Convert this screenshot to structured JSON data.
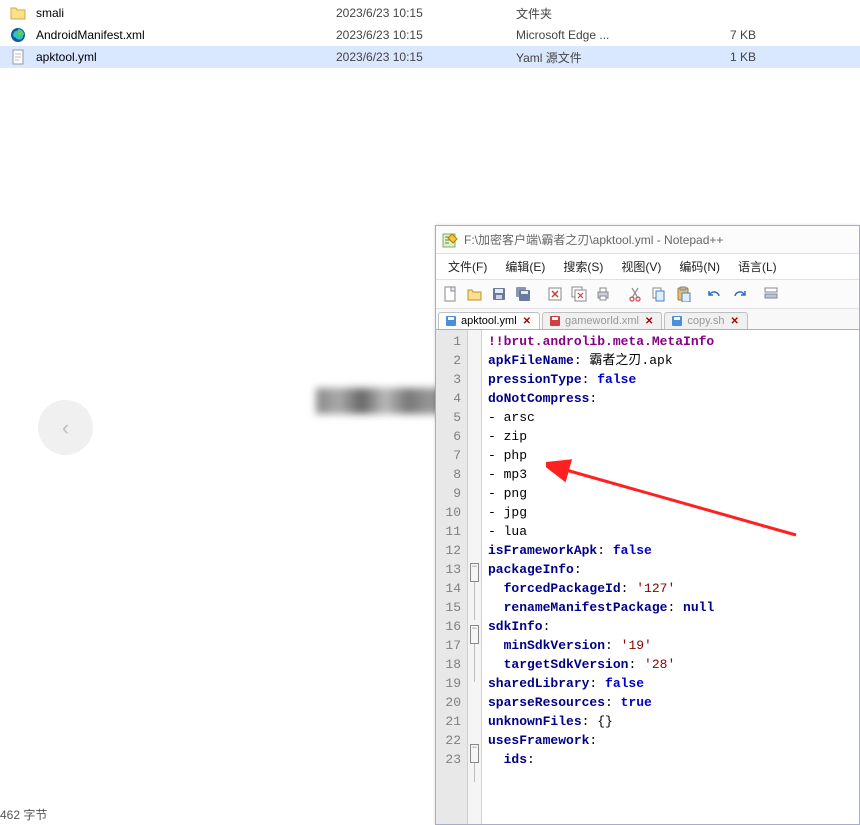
{
  "files": [
    {
      "icon": "folder",
      "name": "smali",
      "date": "2023/6/23 10:15",
      "type": "文件夹",
      "size": ""
    },
    {
      "icon": "edge",
      "name": "AndroidManifest.xml",
      "date": "2023/6/23 10:15",
      "type": "Microsoft Edge ...",
      "size": "7 KB"
    },
    {
      "icon": "file",
      "name": "apktool.yml",
      "date": "2023/6/23 10:15",
      "type": "Yaml 源文件",
      "size": "1 KB",
      "selected": true
    }
  ],
  "npp": {
    "title": "F:\\加密客户端\\霸者之刃\\apktool.yml - Notepad++",
    "menus": [
      "文件(F)",
      "编辑(E)",
      "搜索(S)",
      "视图(V)",
      "编码(N)",
      "语言(L)"
    ],
    "tabs": [
      {
        "label": "apktool.yml",
        "active": true,
        "dirty": false,
        "color": "#4a90d9"
      },
      {
        "label": "gameworld.xml",
        "active": false,
        "dirty": true,
        "color": "#4a90d9"
      },
      {
        "label": "copy.sh",
        "active": false,
        "dirty": false,
        "color": "#4a90d9"
      }
    ],
    "code": {
      "type_tag": "!!brut.androlib.meta.MetaInfo",
      "apkFileName_key": "apkFileName",
      "apkFileName_value": "霸者之刃.apk",
      "compressionType_key": "pressionType",
      "compressionType_value": "false",
      "doNotCompress_key": "doNotCompress",
      "items": [
        "arsc",
        "zip",
        "php",
        "mp3",
        "png",
        "jpg",
        "lua"
      ],
      "isFrameworkApk_key": "isFrameworkApk",
      "isFrameworkApk_value": "false",
      "packageInfo_key": "packageInfo",
      "forcedPackageId_key": "forcedPackageId",
      "forcedPackageId_value": "'127'",
      "renameManifestPackage_key": "renameManifestPackage",
      "renameManifestPackage_value": "null",
      "sdkInfo_key": "sdkInfo",
      "minSdkVersion_key": "minSdkVersion",
      "minSdkVersion_value": "'19'",
      "targetSdkVersion_key": "targetSdkVersion",
      "targetSdkVersion_value": "'28'",
      "sharedLibrary_key": "sharedLibrary",
      "sharedLibrary_value": "false",
      "sparseResources_key": "sparseResources",
      "sparseResources_value": "true",
      "unknownFiles_key": "unknownFiles",
      "unknownFiles_value": "{}",
      "usesFramework_key": "usesFramework",
      "ids_key": "ids"
    },
    "line_count": 23
  },
  "nav": {
    "left": "‹",
    "right": "›"
  },
  "status": "462 字节"
}
